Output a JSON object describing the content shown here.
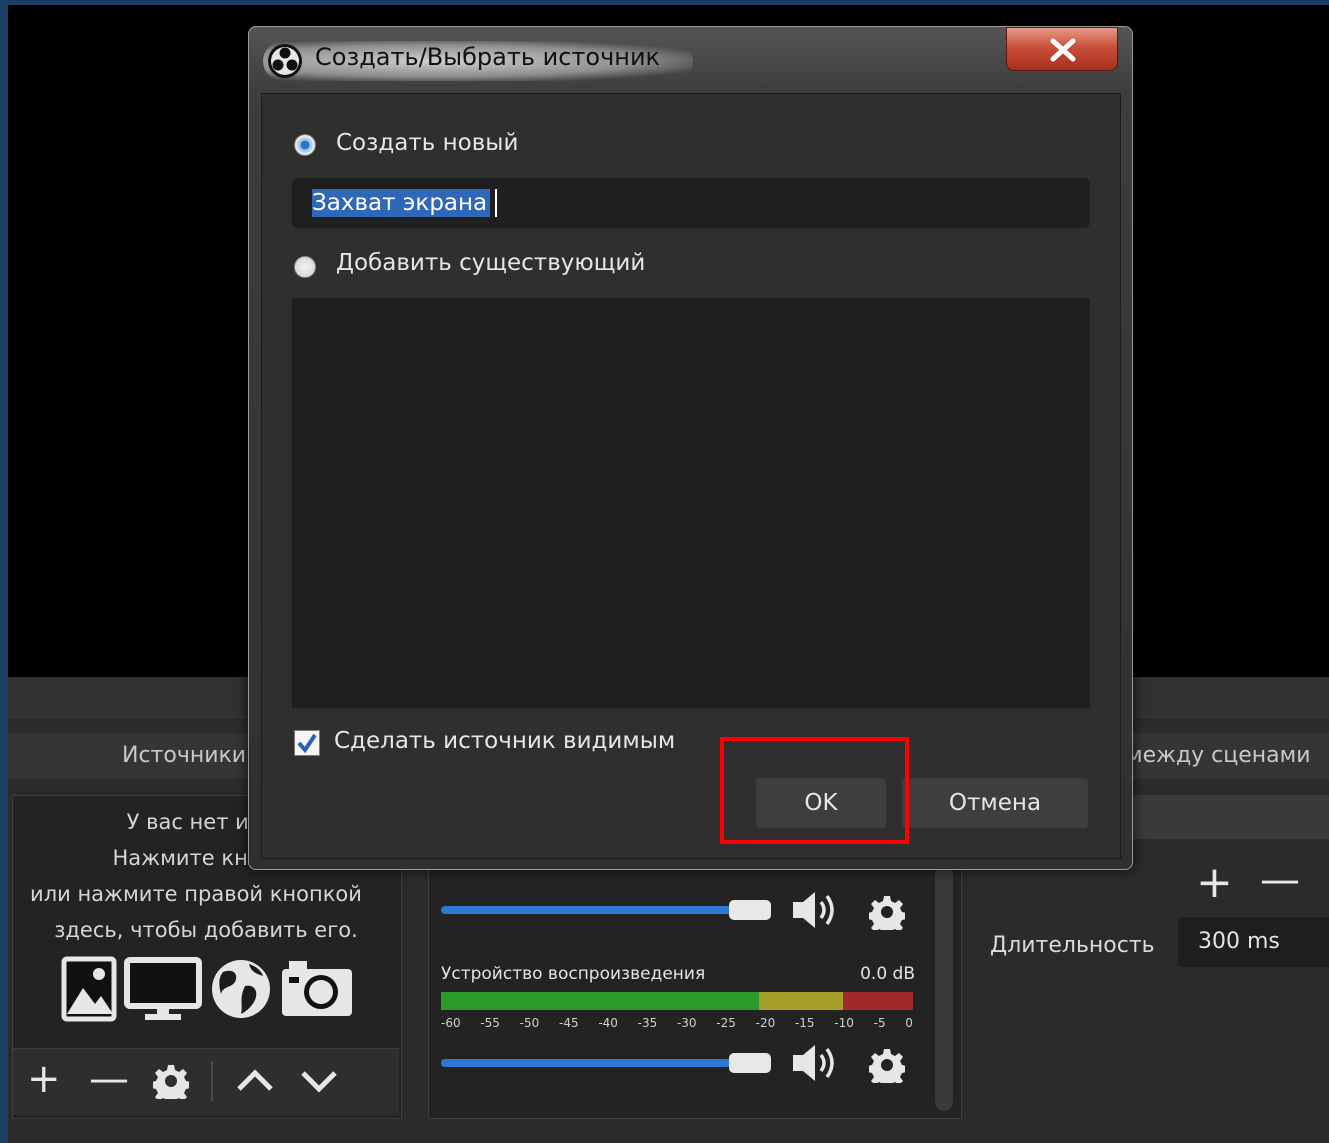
{
  "dialog": {
    "title": "Создать/Выбрать источник",
    "create_new_label": "Создать новый",
    "name_value": "Захват экрана",
    "add_existing_label": "Добавить существующий",
    "visible_checkbox_label": "Сделать источник видимым",
    "ok_label": "OK",
    "cancel_label": "Отмена"
  },
  "docks": {
    "sources_title": "Источники",
    "transitions_title": "между сценами"
  },
  "sources": {
    "empty_line1": "У вас нет исто",
    "empty_line2": "Нажмите кнопку",
    "empty_line3": "или нажмите правой кнопкой",
    "empty_line4": "здесь, чтобы добавить его."
  },
  "mixer": {
    "channel2_name": "Устройство воспроизведения",
    "channel2_db": "0.0 dB",
    "channel2_level": 0.0,
    "scale_ticks": [
      "-60",
      "-55",
      "-50",
      "-45",
      "-40",
      "-35",
      "-30",
      "-25",
      "-20",
      "-15",
      "-10",
      "-5",
      "0"
    ]
  },
  "transitions": {
    "duration_label": "Длительность",
    "duration_value": "300 ms"
  },
  "colors": {
    "accent_blue": "#2b7bd6",
    "highlight_red": "#ff0000",
    "meter_green": "#2a9a2a",
    "meter_yellow": "#a6a02a",
    "meter_red": "#a02a2a"
  }
}
